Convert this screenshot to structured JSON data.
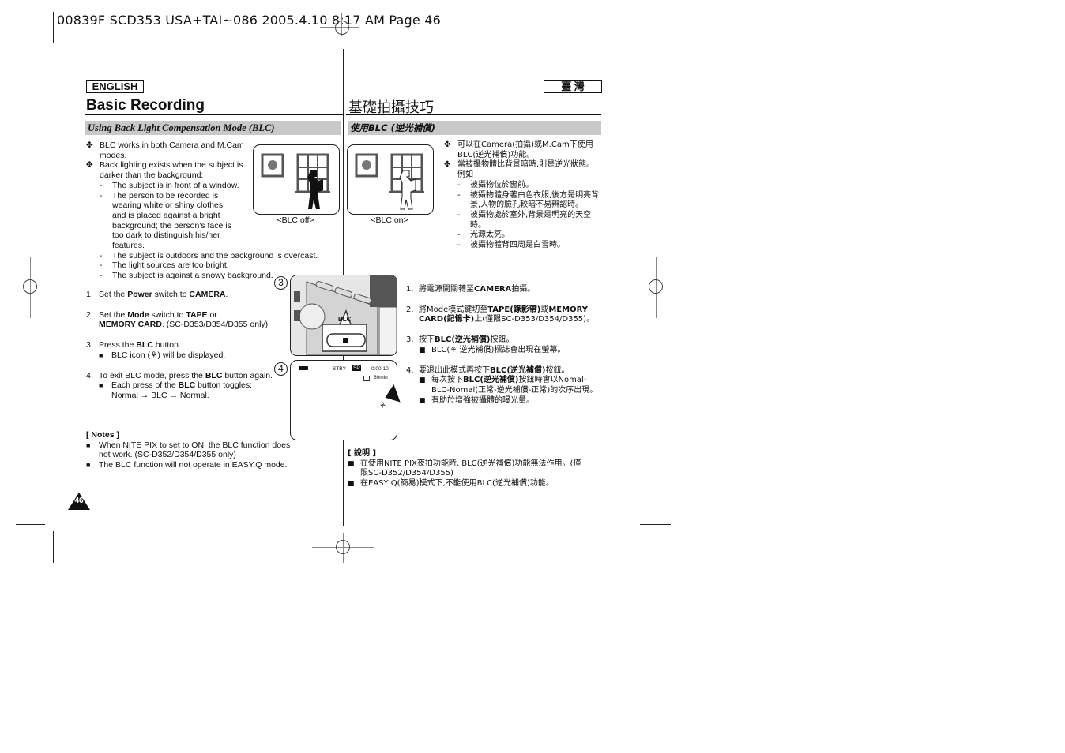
{
  "print_header": "00839F SCD353 USA+TAI~086  2005.4.10  8:17 AM  Page 46",
  "english": {
    "lang_label": "ENGLISH",
    "title": "Basic Recording",
    "section_title": "Using Back Light Compensation Mode (BLC)",
    "bullets": [
      "BLC works in both Camera and M.Cam modes.",
      "Back lighting exists when the subject is darker than the background:"
    ],
    "conditions": [
      "The subject is in front of a window.",
      "The person to be recorded is wearing white or shiny clothes and is placed against a bright background; the person's face is too dark to distinguish his/her features.",
      "The subject is outdoors and the background is overcast.",
      "The light sources are too bright.",
      "The subject is against a snowy background."
    ],
    "steps": [
      {
        "num": "1.",
        "pre": "Set the ",
        "b1": "Power",
        "mid": " switch to ",
        "b2": "CAMERA",
        "post": "."
      },
      {
        "num": "2.",
        "pre": "Set the ",
        "b1": "Mode",
        "mid": " switch to ",
        "b2": "TAPE",
        "post": " or",
        "line2_bold": "MEMORY CARD",
        "line2_rest": ". (SC-D353/D354/D355 only)"
      },
      {
        "num": "3.",
        "pre": "Press the ",
        "b1": "BLC",
        "post": " button.",
        "sub": "BLC icon (⚘) will be displayed."
      },
      {
        "num": "4.",
        "pre": "To exit BLC mode, press the ",
        "b1": "BLC",
        "post": " button again.",
        "sub_pre": "Each press of the ",
        "sub_bold": "BLC",
        "sub_post": " button toggles:",
        "sub_line2": "Normal → BLC → Normal."
      }
    ],
    "notes_title": "[ Notes ]",
    "notes": [
      "When NITE PIX to set to ON, the BLC function does not work. (SC-D352/D354/D355 only)",
      "The BLC function will not operate in EASY.Q mode."
    ],
    "page_number": "46"
  },
  "figures": {
    "blc_off_caption": "<BLC off>",
    "blc_on_caption": "<BLC on>",
    "step3_marker": "3",
    "step4_marker": "4",
    "blc_button_label": "BLC",
    "lcd": {
      "status": "STBY",
      "mode": "SP",
      "timecode": "0:00:10",
      "remaining": "60min"
    }
  },
  "chinese": {
    "lang_label": "臺 灣",
    "title": "基礎拍攝技巧",
    "section_title": "使用BLC (逆光補償)",
    "bullets": [
      "可以在Camera(拍攝)或M.Cam下使用BLC(逆光補償)功能。",
      "當被攝物體比背景暗時,則是逆光狀態。例如"
    ],
    "conditions": [
      "被攝物位於窗前。",
      "被攝物體身著白色衣服,後方是明亮背景,人物的臉孔較暗不易辨認時。",
      "被攝物處於室外,背景是明亮的天空時。",
      "光源太亮。",
      "被攝物體背四周是白雪時。"
    ],
    "steps": [
      {
        "num": "1.",
        "pre": "將電源開關轉至",
        "b1": "CAMERA",
        "post": "拍攝。"
      },
      {
        "num": "2.",
        "pre": "將Mode模式鍵切至",
        "b1": "TAPE(錄影帶)",
        "mid": "或",
        "b2": "MEMORY CARD(記憶卡)",
        "post": "上(僅限SC-D353/D354/D355)。"
      },
      {
        "num": "3.",
        "pre": "按下",
        "b1": "BLC(逆光補償)",
        "post": "按鈕。",
        "sub": "BLC(⚘ 逆光補償)標誌會出現在螢幕。"
      },
      {
        "num": "4.",
        "pre": "要退出此模式再按下",
        "b1": "BLC(逆光補償)",
        "post": "按鈕。",
        "sub_pre": "每次按下",
        "sub_bold": "BLC(逆光補償)",
        "sub_post": "按鈕時會以Nomal-BLC-Nomal(正常-逆光補償-正常)的次序出現。",
        "sub2": "有助於增強被攝體的曝光量。"
      }
    ],
    "notes_title": "[ 說明 ]",
    "notes": [
      "在使用NITE PIX夜拍功能時, BLC(逆光補償)功能無法作用。(僅限SC-D352/D354/D355)",
      "在EASY Q(簡易)模式下,不能使用BLC(逆光補償)功能。"
    ]
  },
  "glyphs": {
    "bullet": "✤",
    "dash": "-",
    "square": "■"
  }
}
